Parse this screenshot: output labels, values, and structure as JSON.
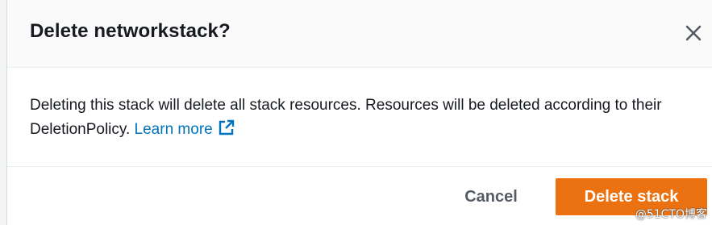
{
  "dialog": {
    "title": "Delete networkstack?",
    "close_icon": "close-icon",
    "body_text": "Deleting this stack will delete all stack resources. Resources will be deleted according to their DeletionPolicy.",
    "learn_more_label": "Learn more",
    "external_link_icon": "external-link-icon",
    "cancel_label": "Cancel",
    "delete_label": "Delete stack"
  },
  "watermark": "@51CTO博客",
  "colors": {
    "primary_button": "#ec7211",
    "link": "#0073bb",
    "text": "#16191f",
    "secondary_text": "#545b64"
  }
}
